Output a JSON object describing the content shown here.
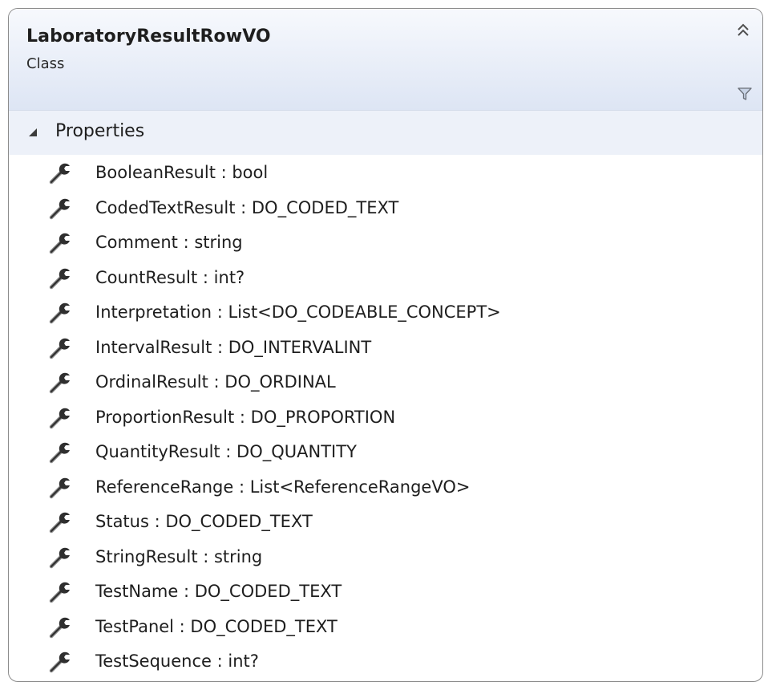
{
  "class_shape": {
    "name": "LaboratoryResultRowVO",
    "kind": "Class",
    "collapse_icon": "double-chevron-up-icon",
    "filter_icon": "funnel-filter-icon",
    "section": {
      "title": "Properties",
      "toggle_icon": "expanded-triangle-icon",
      "items": [
        {
          "label": "BooleanResult : bool",
          "icon": "wrench-property-icon"
        },
        {
          "label": "CodedTextResult : DO_CODED_TEXT",
          "icon": "wrench-property-icon"
        },
        {
          "label": "Comment : string",
          "icon": "wrench-property-icon"
        },
        {
          "label": "CountResult : int?",
          "icon": "wrench-property-icon"
        },
        {
          "label": "Interpretation : List<DO_CODEABLE_CONCEPT>",
          "icon": "wrench-property-icon"
        },
        {
          "label": "IntervalResult : DO_INTERVALINT",
          "icon": "wrench-property-icon"
        },
        {
          "label": "OrdinalResult : DO_ORDINAL",
          "icon": "wrench-property-icon"
        },
        {
          "label": "ProportionResult : DO_PROPORTION",
          "icon": "wrench-property-icon"
        },
        {
          "label": "QuantityResult : DO_QUANTITY",
          "icon": "wrench-property-icon"
        },
        {
          "label": "ReferenceRange : List<ReferenceRangeVO>",
          "icon": "wrench-property-icon"
        },
        {
          "label": "Status : DO_CODED_TEXT",
          "icon": "wrench-property-icon"
        },
        {
          "label": "StringResult : string",
          "icon": "wrench-property-icon"
        },
        {
          "label": "TestName : DO_CODED_TEXT",
          "icon": "wrench-property-icon"
        },
        {
          "label": "TestPanel : DO_CODED_TEXT",
          "icon": "wrench-property-icon"
        },
        {
          "label": "TestSequence : int?",
          "icon": "wrench-property-icon"
        }
      ]
    }
  },
  "colors": {
    "header_top": "#f7f9fd",
    "header_bottom": "#dde5f4",
    "section_bg": "#edf1f9",
    "border": "#8c8c8c"
  }
}
